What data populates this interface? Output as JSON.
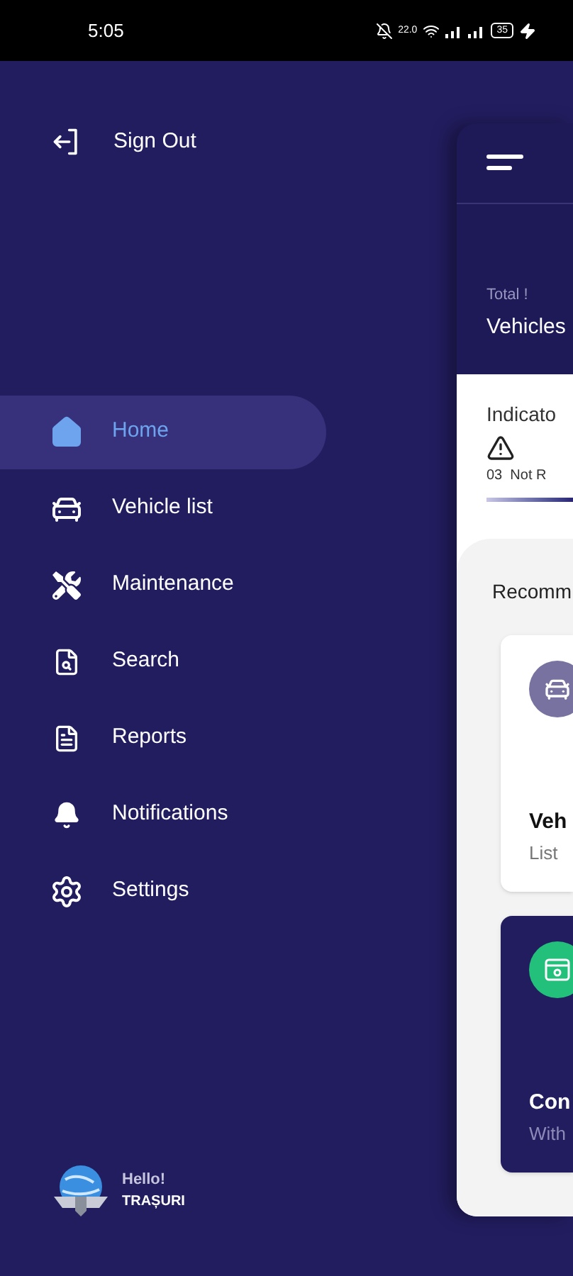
{
  "status_bar": {
    "time": "5:05",
    "speed": "22.0",
    "battery": "35"
  },
  "sign_out": {
    "label": "Sign Out"
  },
  "menu": [
    {
      "kind": "home",
      "label": "Home",
      "selected": true
    },
    {
      "kind": "vehicle",
      "label": "Vehicle list",
      "selected": false
    },
    {
      "kind": "maintenance",
      "label": "Maintenance",
      "selected": false
    },
    {
      "kind": "search",
      "label": "Search",
      "selected": false
    },
    {
      "kind": "reports",
      "label": "Reports",
      "selected": false
    },
    {
      "kind": "notifications",
      "label": "Notifications",
      "selected": false
    },
    {
      "kind": "settings",
      "label": "Settings",
      "selected": false
    }
  ],
  "profile": {
    "greeting": "Hello!",
    "name": "TRAȘURI"
  },
  "main": {
    "total_label": "Total !",
    "total_title": "Vehicles",
    "indicator_title": "Indicato",
    "indicator_text": "03  Not R",
    "indicator_level": {
      "level": 1
    },
    "section_title": "Recomm",
    "cards": [
      {
        "kind": "light",
        "title": "Veh",
        "subtitle": "List"
      },
      {
        "kind": "dark",
        "title": "Con",
        "subtitle": "With"
      }
    ]
  }
}
